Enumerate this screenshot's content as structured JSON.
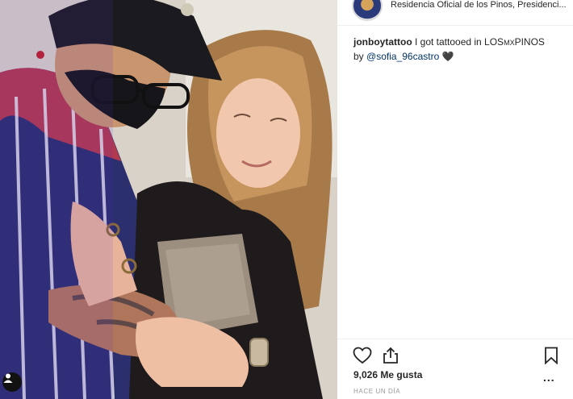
{
  "header": {
    "location": "Residencia Oficial de los Pinos, Presidenci..."
  },
  "caption": {
    "username": "jonboytattoo",
    "text_before": " I got tattooed in LOS",
    "text_small": "MX",
    "text_after": "PINOS",
    "line2_prefix": "by ",
    "mention": "@sofia_96castro",
    "emoji": "🖤"
  },
  "actions": {
    "like_icon": "heart-icon",
    "share_icon": "share-icon",
    "save_icon": "bookmark-icon",
    "more_icon": "more-options-icon"
  },
  "stats": {
    "likes": "9,026 Me gusta",
    "more": "...",
    "timestamp": "HACE UN DÍA"
  }
}
